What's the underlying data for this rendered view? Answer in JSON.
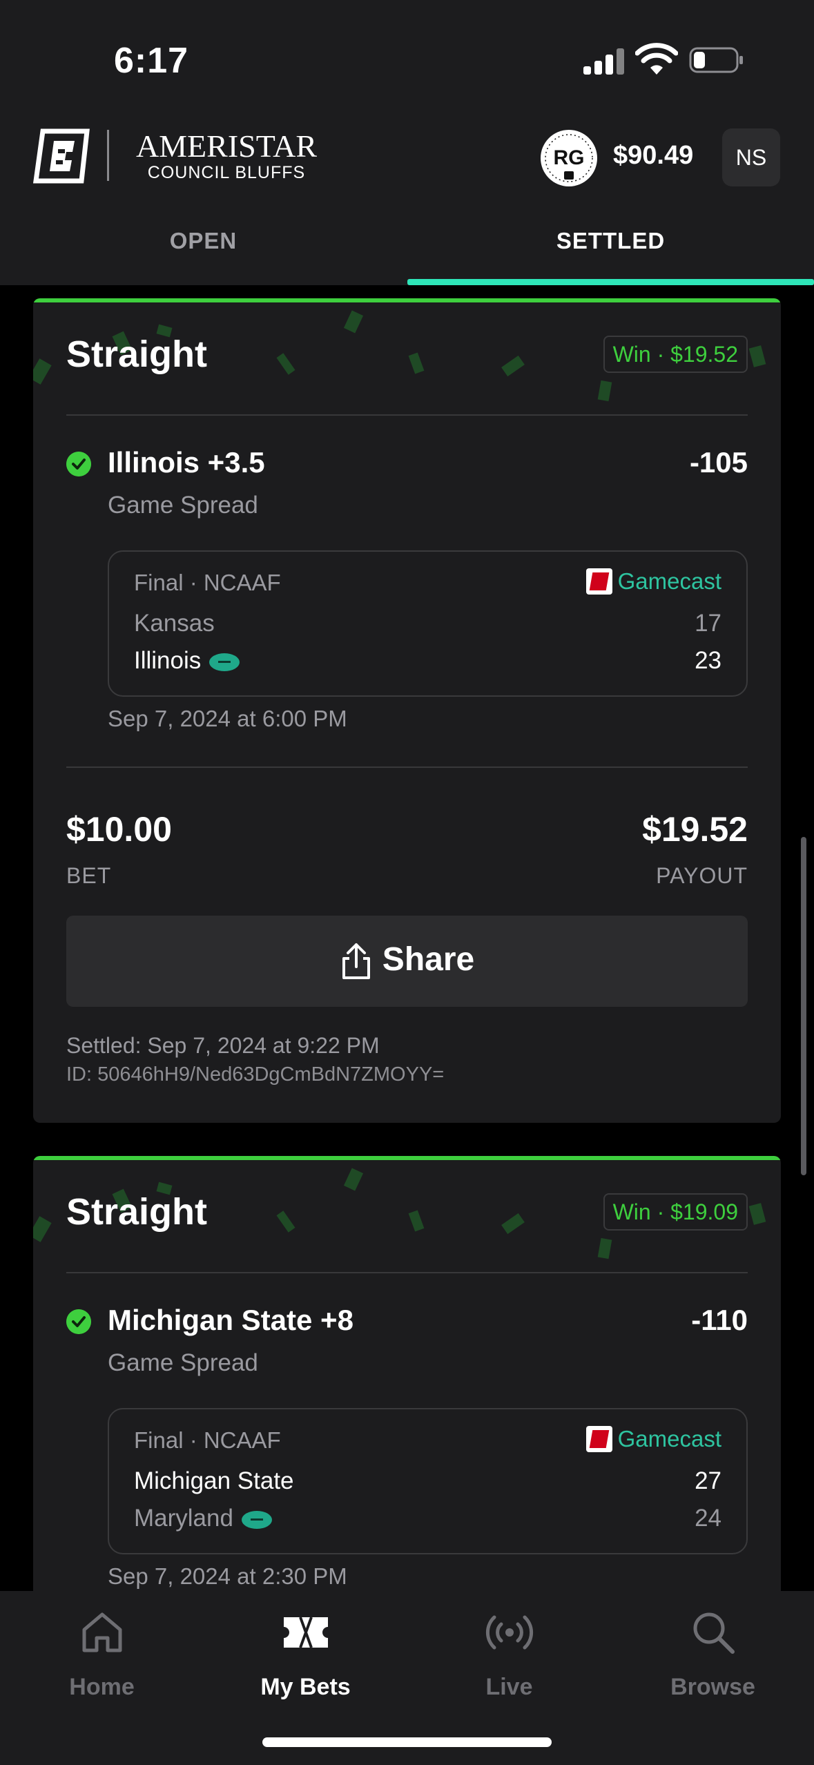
{
  "status_bar": {
    "time": "6:17"
  },
  "header": {
    "brand_line1": "AMERISTAR",
    "brand_line2": "COUNCIL BLUFFS",
    "rg_badge": "RG",
    "balance": "$90.49",
    "user_initials": "NS"
  },
  "tabs": [
    {
      "label": "OPEN",
      "selected": false
    },
    {
      "label": "SETTLED",
      "selected": true
    }
  ],
  "bets": [
    {
      "type": "Straight",
      "result_badge": "Win · $19.52",
      "pick": "Illinois +3.5",
      "odds": "-105",
      "market": "Game Spread",
      "game": {
        "status": "Final · NCAAF",
        "gamecast_label": "Gamecast",
        "teams": [
          {
            "name": "Kansas",
            "score": "17",
            "winner": false
          },
          {
            "name": "Illinois",
            "score": "23",
            "winner": true
          }
        ]
      },
      "date": "Sep 7, 2024 at 6:00 PM",
      "bet_amount": "$10.00",
      "bet_label": "BET",
      "payout": "$19.52",
      "payout_label": "PAYOUT",
      "share_label": "Share",
      "settled": "Settled: Sep 7, 2024 at 9:22 PM",
      "id": "ID: 50646hH9/Ned63DgCmBdN7ZMOYY="
    },
    {
      "type": "Straight",
      "result_badge": "Win · $19.09",
      "pick": "Michigan State +8",
      "odds": "-110",
      "market": "Game Spread",
      "game": {
        "status": "Final · NCAAF",
        "gamecast_label": "Gamecast",
        "teams": [
          {
            "name": "Michigan State",
            "score": "27",
            "winner": true
          },
          {
            "name": "Maryland",
            "score": "24",
            "winner": false
          }
        ]
      },
      "date": "Sep 7, 2024 at 2:30 PM"
    }
  ],
  "bottom_nav": [
    {
      "label": "Home",
      "icon": "home-icon",
      "active": false
    },
    {
      "label": "My Bets",
      "icon": "ticket-icon",
      "active": true
    },
    {
      "label": "Live",
      "icon": "live-broadcast-icon",
      "active": false
    },
    {
      "label": "Browse",
      "icon": "search-icon",
      "active": false
    }
  ],
  "colors": {
    "accent": "#2ee5b8",
    "win": "#3ecf3e",
    "background": "#000000",
    "surface": "#1c1c1e"
  }
}
